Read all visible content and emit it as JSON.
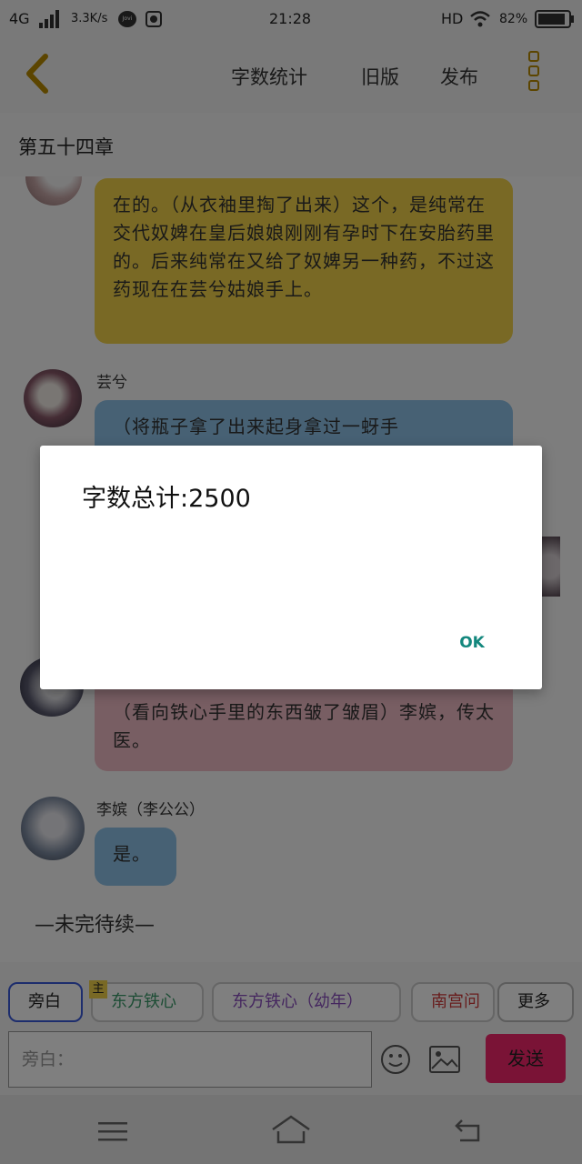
{
  "status_bar": {
    "network": "4G",
    "speed": "3.3K/s",
    "jovi": "Jovi",
    "time": "21:28",
    "hd": "HD",
    "battery": "82%"
  },
  "header": {
    "word_count_link": "字数统计",
    "old_version_link": "旧版",
    "publish_link": "发布"
  },
  "chapter": {
    "title": "第五十四章"
  },
  "messages": [
    {
      "text": "在的。（从衣袖里掏了出来）这个，是纯常在交代奴婢在皇后娘娘刚刚有孕时下在安胎药里的。后来纯常在又给了奴婢另一种药，不过这药现在在芸兮姑娘手上。",
      "color": "#f2d34a"
    },
    {
      "name": "芸兮",
      "text": "（将瓶子拿了出来起身拿过一蚜手",
      "color": "#8ec2e8"
    },
    {
      "text": "（看向铁心手里的东西皱了皱眉）李嫔，传太医。",
      "color": "#f0bcc6"
    },
    {
      "name": "李嫔（李公公）",
      "text": "是。",
      "color": "#8ec2e8"
    }
  ],
  "end_marker": "—未完待续—",
  "roles": [
    {
      "label": "旁白"
    },
    {
      "label": "东方铁心",
      "badge": "主"
    },
    {
      "label": "东方铁心（幼年）"
    },
    {
      "label": "南宫问"
    }
  ],
  "more_button": "更多",
  "input": {
    "placeholder": "旁白："
  },
  "send_button": "发送",
  "dialog": {
    "message": "字数总计:2500",
    "ok_button": "OK"
  },
  "colors": {
    "accent_yellow": "#b88b00",
    "send_pink": "#f4276d",
    "dialog_ok": "#13877d"
  }
}
